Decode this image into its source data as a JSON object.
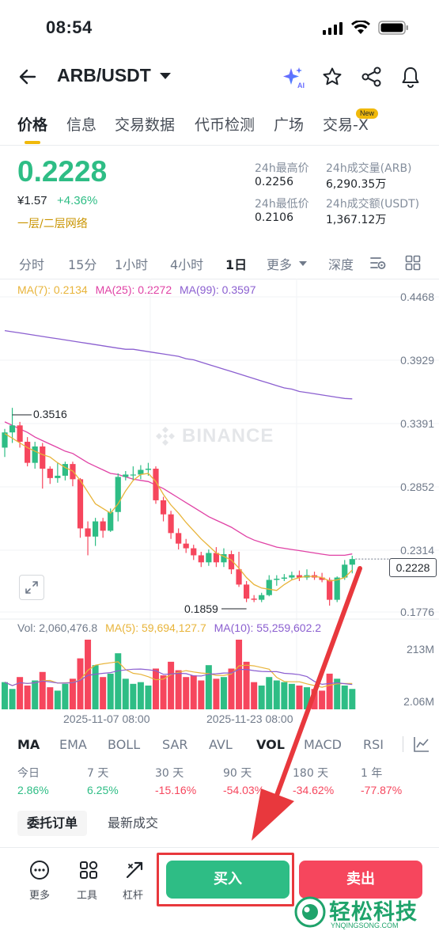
{
  "status": {
    "time": "08:54"
  },
  "header": {
    "pair": "ARB/USDT"
  },
  "tabs": [
    {
      "label": "价格"
    },
    {
      "label": "信息"
    },
    {
      "label": "交易数据"
    },
    {
      "label": "代币检测"
    },
    {
      "label": "广场"
    },
    {
      "label": "交易-X",
      "badge": "New"
    }
  ],
  "price": {
    "last": "0.2228",
    "cny": "¥1.57",
    "change": "+4.36%",
    "network": "一层/二层网络"
  },
  "stats": {
    "high_label": "24h最高价",
    "high": "0.2256",
    "low_label": "24h最低价",
    "low": "0.2106",
    "vol_label": "24h成交量(ARB)",
    "vol": "6,290.35万",
    "amount_label": "24h成交额(USDT)",
    "amount": "1,367.12万"
  },
  "intervals": [
    "分时",
    "15分",
    "1小时",
    "4小时",
    "1日",
    "更多",
    "深度"
  ],
  "ma_line": {
    "ma7": "MA(7): 0.2134",
    "ma25": "MA(25): 0.2272",
    "ma99": "MA(99): 0.3597"
  },
  "vol_line": {
    "vol": "Vol: 2,060,476.8",
    "ma5": "MA(5): 59,694,127.7",
    "ma10": "MA(10): 55,259,602.2"
  },
  "watermark": "BINANCE",
  "chart_data": {
    "type": "candlestick",
    "y_ticks": [
      "0.4468",
      "0.3929",
      "0.3391",
      "0.2852",
      "0.2314",
      "0.1776"
    ],
    "y_range": [
      0.1776,
      0.4468
    ],
    "current_price": "0.2228",
    "max_marker": "0.3516",
    "min_marker": "0.1859",
    "vol_ticks": [
      "213M",
      "2.06M"
    ],
    "x_labels": [
      "2025-11-07 08:00",
      "2025-11-23 08:00"
    ],
    "colors": {
      "up": "#2ebd85",
      "down": "#f6465d",
      "ma7": "#e8b43a",
      "ma25": "#e042a5",
      "ma99": "#8b5fd0"
    },
    "candles": [
      {
        "o": 0.318,
        "c": 0.331,
        "h": 0.334,
        "l": 0.31
      },
      {
        "o": 0.331,
        "c": 0.337,
        "h": 0.352,
        "l": 0.322
      },
      {
        "o": 0.337,
        "c": 0.323,
        "h": 0.34,
        "l": 0.318
      },
      {
        "o": 0.323,
        "c": 0.305,
        "h": 0.327,
        "l": 0.302
      },
      {
        "o": 0.305,
        "c": 0.319,
        "h": 0.323,
        "l": 0.3
      },
      {
        "o": 0.319,
        "c": 0.3,
        "h": 0.322,
        "l": 0.283
      },
      {
        "o": 0.3,
        "c": 0.292,
        "h": 0.302,
        "l": 0.287
      },
      {
        "o": 0.292,
        "c": 0.294,
        "h": 0.305,
        "l": 0.288
      },
      {
        "o": 0.294,
        "c": 0.304,
        "h": 0.306,
        "l": 0.29
      },
      {
        "o": 0.304,
        "c": 0.291,
        "h": 0.306,
        "l": 0.285
      },
      {
        "o": 0.291,
        "c": 0.249,
        "h": 0.292,
        "l": 0.241
      },
      {
        "o": 0.249,
        "c": 0.242,
        "h": 0.255,
        "l": 0.226
      },
      {
        "o": 0.242,
        "c": 0.255,
        "h": 0.258,
        "l": 0.234
      },
      {
        "o": 0.255,
        "c": 0.247,
        "h": 0.258,
        "l": 0.241
      },
      {
        "o": 0.247,
        "c": 0.263,
        "h": 0.266,
        "l": 0.246
      },
      {
        "o": 0.263,
        "c": 0.293,
        "h": 0.296,
        "l": 0.255
      },
      {
        "o": 0.293,
        "c": 0.295,
        "h": 0.298,
        "l": 0.29
      },
      {
        "o": 0.295,
        "c": 0.295,
        "h": 0.302,
        "l": 0.29
      },
      {
        "o": 0.295,
        "c": 0.299,
        "h": 0.303,
        "l": 0.291
      },
      {
        "o": 0.299,
        "c": 0.3,
        "h": 0.305,
        "l": 0.294
      },
      {
        "o": 0.3,
        "c": 0.273,
        "h": 0.302,
        "l": 0.27
      },
      {
        "o": 0.273,
        "c": 0.261,
        "h": 0.276,
        "l": 0.255
      },
      {
        "o": 0.261,
        "c": 0.245,
        "h": 0.264,
        "l": 0.24
      },
      {
        "o": 0.245,
        "c": 0.236,
        "h": 0.249,
        "l": 0.231
      },
      {
        "o": 0.236,
        "c": 0.232,
        "h": 0.24,
        "l": 0.228
      },
      {
        "o": 0.232,
        "c": 0.226,
        "h": 0.235,
        "l": 0.222
      },
      {
        "o": 0.226,
        "c": 0.22,
        "h": 0.229,
        "l": 0.216
      },
      {
        "o": 0.22,
        "c": 0.228,
        "h": 0.231,
        "l": 0.217
      },
      {
        "o": 0.228,
        "c": 0.22,
        "h": 0.233,
        "l": 0.216
      },
      {
        "o": 0.22,
        "c": 0.227,
        "h": 0.232,
        "l": 0.216
      },
      {
        "o": 0.227,
        "c": 0.214,
        "h": 0.23,
        "l": 0.21
      },
      {
        "o": 0.214,
        "c": 0.201,
        "h": 0.229,
        "l": 0.199
      },
      {
        "o": 0.201,
        "c": 0.189,
        "h": 0.204,
        "l": 0.186
      },
      {
        "o": 0.189,
        "c": 0.188,
        "h": 0.192,
        "l": 0.186
      },
      {
        "o": 0.188,
        "c": 0.192,
        "h": 0.194,
        "l": 0.186
      },
      {
        "o": 0.192,
        "c": 0.205,
        "h": 0.209,
        "l": 0.191
      },
      {
        "o": 0.205,
        "c": 0.206,
        "h": 0.209,
        "l": 0.2
      },
      {
        "o": 0.206,
        "c": 0.207,
        "h": 0.21,
        "l": 0.204
      },
      {
        "o": 0.207,
        "c": 0.209,
        "h": 0.212,
        "l": 0.205
      },
      {
        "o": 0.209,
        "c": 0.207,
        "h": 0.213,
        "l": 0.204
      },
      {
        "o": 0.207,
        "c": 0.209,
        "h": 0.214,
        "l": 0.205
      },
      {
        "o": 0.209,
        "c": 0.207,
        "h": 0.212,
        "l": 0.205
      },
      {
        "o": 0.207,
        "c": 0.205,
        "h": 0.211,
        "l": 0.203
      },
      {
        "o": 0.205,
        "c": 0.188,
        "h": 0.207,
        "l": 0.183
      },
      {
        "o": 0.188,
        "c": 0.207,
        "h": 0.208,
        "l": 0.186
      },
      {
        "o": 0.207,
        "c": 0.218,
        "h": 0.222,
        "l": 0.205
      },
      {
        "o": 0.218,
        "c": 0.2228,
        "h": 0.2256,
        "l": 0.2106
      }
    ],
    "volumes": [
      80,
      60,
      95,
      70,
      85,
      110,
      65,
      55,
      75,
      90,
      150,
      205,
      130,
      95,
      105,
      165,
      90,
      75,
      80,
      70,
      120,
      100,
      140,
      115,
      95,
      100,
      85,
      130,
      90,
      95,
      120,
      205,
      140,
      80,
      70,
      95,
      85,
      80,
      75,
      70,
      65,
      60,
      55,
      105,
      90,
      70,
      60
    ],
    "ma7": [
      0.33,
      0.326,
      0.322,
      0.318,
      0.315,
      0.312,
      0.31,
      0.305,
      0.301,
      0.298,
      0.29,
      0.28,
      0.27,
      0.266,
      0.262,
      0.27,
      0.281,
      0.29,
      0.295,
      0.296,
      0.289,
      0.278,
      0.269,
      0.262,
      0.254,
      0.247,
      0.24,
      0.234,
      0.228,
      0.225,
      0.222,
      0.215,
      0.207,
      0.201,
      0.198,
      0.197,
      0.196,
      0.201,
      0.205,
      0.207,
      0.208,
      0.208,
      0.207,
      0.204,
      0.205,
      0.207,
      0.2134
    ],
    "ma25": [
      0.34,
      0.337,
      0.334,
      0.331,
      0.327,
      0.324,
      0.321,
      0.318,
      0.315,
      0.313,
      0.309,
      0.305,
      0.302,
      0.299,
      0.296,
      0.295,
      0.293,
      0.291,
      0.29,
      0.289,
      0.286,
      0.283,
      0.279,
      0.275,
      0.271,
      0.267,
      0.263,
      0.259,
      0.256,
      0.253,
      0.25,
      0.246,
      0.242,
      0.239,
      0.237,
      0.235,
      0.233,
      0.232,
      0.231,
      0.23,
      0.229,
      0.228,
      0.227,
      0.226,
      0.226,
      0.226,
      0.2272
    ],
    "ma99": [
      0.418,
      0.417,
      0.416,
      0.415,
      0.414,
      0.413,
      0.412,
      0.411,
      0.41,
      0.409,
      0.408,
      0.407,
      0.406,
      0.405,
      0.404,
      0.403,
      0.402,
      0.402,
      0.401,
      0.4,
      0.399,
      0.398,
      0.397,
      0.396,
      0.394,
      0.393,
      0.391,
      0.389,
      0.387,
      0.385,
      0.383,
      0.381,
      0.379,
      0.377,
      0.375,
      0.373,
      0.371,
      0.369,
      0.368,
      0.366,
      0.365,
      0.364,
      0.363,
      0.362,
      0.361,
      0.36,
      0.3597
    ]
  },
  "indicator_tabs": [
    "MA",
    "EMA",
    "BOLL",
    "SAR",
    "AVL",
    "VOL",
    "MACD",
    "RSI"
  ],
  "performance": [
    {
      "label": "今日",
      "value": "2.86%",
      "dir": "up"
    },
    {
      "label": "7 天",
      "value": "6.25%",
      "dir": "up"
    },
    {
      "label": "30 天",
      "value": "-15.16%",
      "dir": "down"
    },
    {
      "label": "90 天",
      "value": "-54.03%",
      "dir": "down"
    },
    {
      "label": "180 天",
      "value": "-34.62%",
      "dir": "down"
    },
    {
      "label": "1 年",
      "value": "-77.87%",
      "dir": "down"
    }
  ],
  "order_tabs": [
    "委托订单",
    "最新成交"
  ],
  "bottom": {
    "more": "更多",
    "tools": "工具",
    "leverage": "杠杆",
    "buy": "买入",
    "sell": "卖出"
  },
  "watermark_logo": {
    "text": "轻松科技",
    "sub": "YNQINGSONG.COM"
  }
}
